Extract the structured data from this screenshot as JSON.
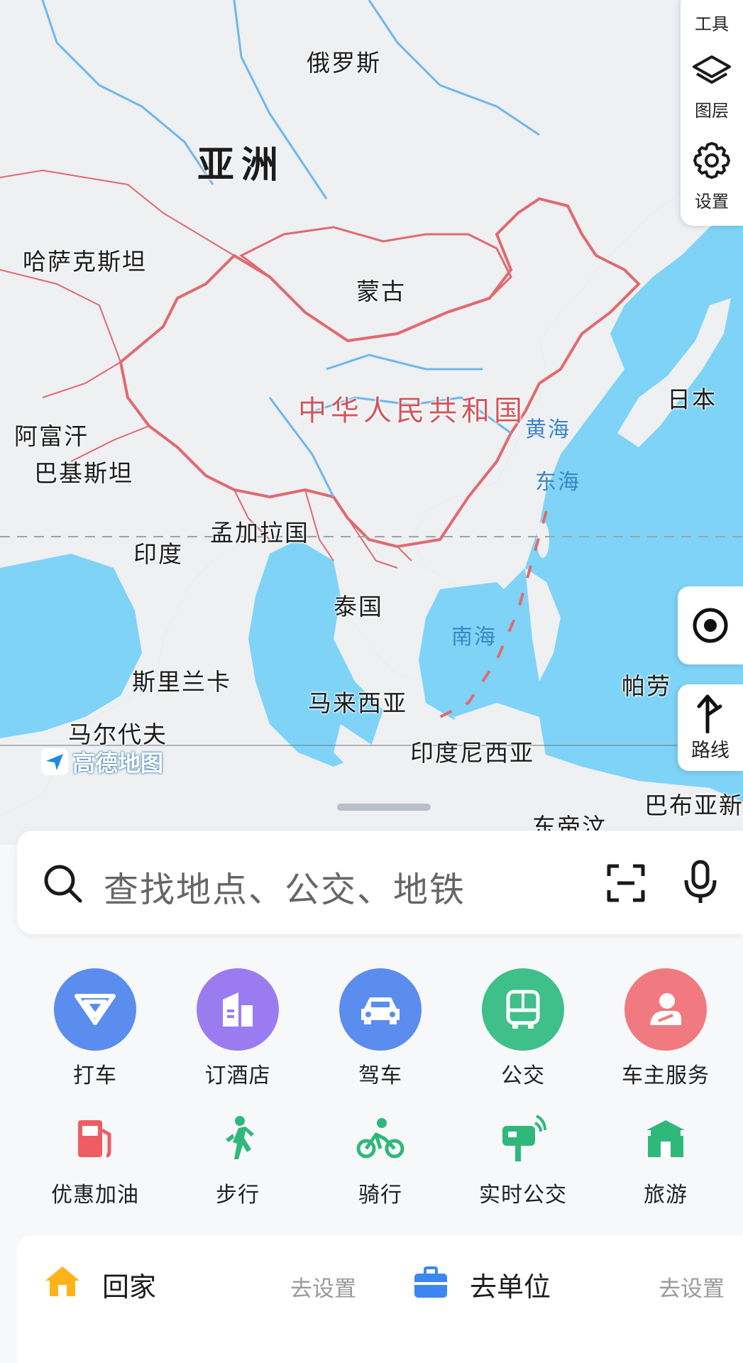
{
  "map": {
    "labels": {
      "russia": "俄罗斯",
      "asia": "亚洲",
      "kazakhstan": "哈萨克斯坦",
      "mongolia": "蒙古",
      "china": "中华人民共和国",
      "japan": "日本",
      "yellow_sea": "黄海",
      "east_sea": "东海",
      "afghanistan": "阿富汗",
      "pakistan": "巴基斯坦",
      "bangladesh": "孟加拉国",
      "india": "印度",
      "thailand": "泰国",
      "south_sea": "南海",
      "sri_lanka": "斯里兰卡",
      "malaysia": "马来西亚",
      "palau": "帕劳",
      "maldives": "马尔代夫",
      "indonesia": "印度尼西亚",
      "papua": "巴布亚新",
      "east_timor": "东帝汶"
    },
    "logo_text": "高德地图",
    "colors": {
      "sea": "#7fd3f7",
      "land": "#eef0f2",
      "border": "#e06a70",
      "river": "#6fb7ea"
    }
  },
  "tools": {
    "tools_label": "工具",
    "layers_label": "图层",
    "settings_label": "设置",
    "route_label": "路线"
  },
  "search": {
    "placeholder": "查找地点、公交、地铁"
  },
  "services": [
    {
      "label": "打车",
      "icon": "taxi-icon",
      "color": "#5b8def"
    },
    {
      "label": "订酒店",
      "icon": "hotel-icon",
      "color": "#9b7cf0"
    },
    {
      "label": "驾车",
      "icon": "car-icon",
      "color": "#5b8def"
    },
    {
      "label": "公交",
      "icon": "bus-icon",
      "color": "#3fbf8a"
    },
    {
      "label": "车主服务",
      "icon": "car-owner-icon",
      "color": "#f07a80"
    }
  ],
  "services2": [
    {
      "label": "优惠加油",
      "icon": "fuel-icon",
      "color": "#ef5d62"
    },
    {
      "label": "步行",
      "icon": "walk-icon",
      "color": "#2fb87a"
    },
    {
      "label": "骑行",
      "icon": "bike-icon",
      "color": "#2fb87a"
    },
    {
      "label": "实时公交",
      "icon": "realtime-bus-icon",
      "color": "#2fb87a"
    },
    {
      "label": "旅游",
      "icon": "travel-icon",
      "color": "#2fb87a"
    }
  ],
  "shortcuts": {
    "home": {
      "label": "回家",
      "action": "去设置"
    },
    "work": {
      "label": "去单位",
      "action": "去设置"
    }
  }
}
